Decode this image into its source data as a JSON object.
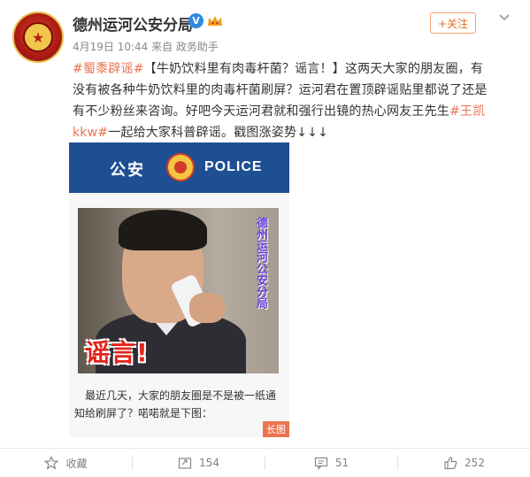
{
  "header": {
    "account_name": "德州运河公安分局",
    "verified_badge": "V",
    "meta": "4月19日 10:44 来自 政务助手",
    "follow_label": "+关注"
  },
  "post": {
    "hashtag1": "#蜀黍辟谣#",
    "text1": "【牛奶饮料里有肉毒杆菌？谣言！】这两天大家的朋友圈，有没有被各种牛奶饮料里的肉毒杆菌刷屏？运河君在置顶辟谣贴里都说了还是有不少粉丝来咨询。好吧今天运河君就和强行出镜的热心网友王先生",
    "hashtag2": "#王凯kkw#",
    "text2": "一起给大家科普辟谣。戳图涨姿势↓↓↓"
  },
  "card": {
    "banner_cn": "公安",
    "banner_en": "POLICE",
    "rumor_label": "谣言!",
    "vertical_caption": "德州运河公安分局",
    "body_text": "最近几天，大家的朋友圈是不是被一纸通知给刷屏了？喏喏就是下图：",
    "long_image_tag": "长图"
  },
  "actions": {
    "favorite_label": "收藏",
    "repost_count": "154",
    "comment_count": "51",
    "like_count": "252"
  },
  "colors": {
    "accent": "#eb7350",
    "banner": "#1f4f93",
    "verified": "#2f8ae0"
  }
}
